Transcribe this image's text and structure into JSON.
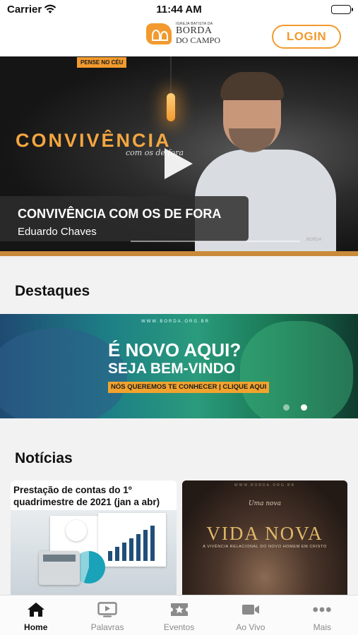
{
  "status_bar": {
    "carrier": "Carrier",
    "time": "11:44 AM"
  },
  "header": {
    "logo": {
      "line1": "IGREJA BATISTA DA",
      "line2": "BORDA",
      "line3": "DO CAMPO"
    },
    "login_label": "LOGIN"
  },
  "hero": {
    "tag": "PENSE NO CÉU",
    "graphic_title": "CONVIVÊNCIA",
    "graphic_script": "com os de fora",
    "title": "CONVIVÊNCIA COM OS DE FORA",
    "author": "Eduardo Chaves",
    "watermark": "BORDA",
    "progress": 1.0
  },
  "sections": {
    "highlights": "Destaques",
    "news": "Notícias"
  },
  "banner": {
    "url": "WWW.BORDA.ORG.BR",
    "headline": "É NOVO AQUI?",
    "subheadline": "SEJA BEM-VINDO",
    "cta": "NÓS QUEREMOS TE CONHECER | CLIQUE AQUI",
    "slide_count": 2,
    "active_slide": 2
  },
  "news": [
    {
      "title": "Prestação de contas do 1º quadrimestre de 2021 (jan a abr)"
    },
    {
      "url": "WWW.BORDA.ORG.BR",
      "kicker": "Uma nova",
      "graphic_title": "VIDA NOVA",
      "graphic_sub": "A VIVÊNCIA RELACIONAL DO NOVO HOMEM EM CRISTO"
    }
  ],
  "tabs": [
    {
      "label": "Home",
      "icon": "home-icon",
      "active": true
    },
    {
      "label": "Palavras",
      "icon": "tv-play-icon",
      "active": false
    },
    {
      "label": "Eventos",
      "icon": "ticket-star-icon",
      "active": false
    },
    {
      "label": "Ao Vivo",
      "icon": "video-camera-icon",
      "active": false
    },
    {
      "label": "Mais",
      "icon": "more-dots-icon",
      "active": false
    }
  ],
  "colors": {
    "accent": "#f29a2e",
    "tab_active": "#111111",
    "tab_inactive": "#8a8a8a"
  }
}
